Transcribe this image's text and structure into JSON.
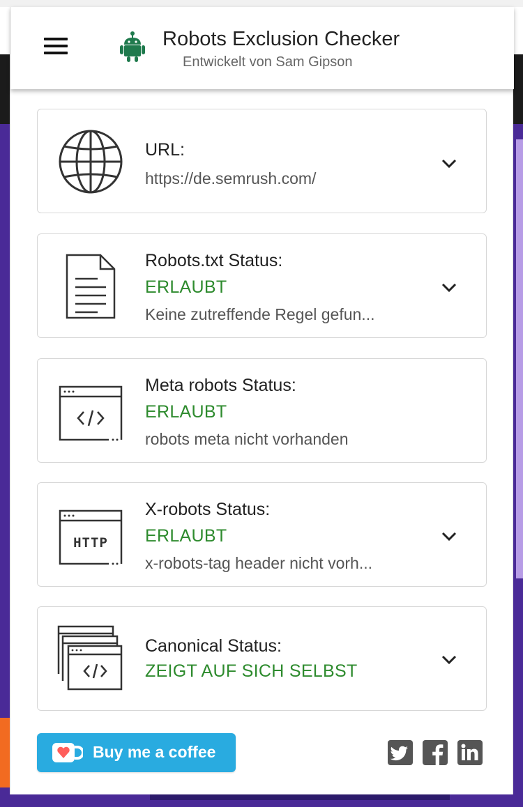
{
  "header": {
    "title": "Robots Exclusion Checker",
    "subtitle": "Entwickelt von Sam Gipson"
  },
  "cards": [
    {
      "label": "URL:",
      "status": "",
      "detail": "https://de.semrush.com/",
      "icon": "globe-icon"
    },
    {
      "label": "Robots.txt Status:",
      "status": "ERLAUBT",
      "detail": "Keine zutreffende Regel gefun...",
      "icon": "document-icon"
    },
    {
      "label": "Meta robots Status:",
      "status": "ERLAUBT",
      "detail": "robots meta nicht vorhanden",
      "icon": "code-window-icon"
    },
    {
      "label": "X-robots Status:",
      "status": "ERLAUBT",
      "detail": "x-robots-tag header nicht vorh...",
      "icon": "http-window-icon"
    },
    {
      "label": "Canonical Status:",
      "status": "ZEIGT AUF SICH SELBST",
      "detail": "",
      "icon": "stacked-windows-icon"
    }
  ],
  "footer": {
    "coffee_label": "Buy me a coffee",
    "icons": [
      "twitter-icon",
      "facebook-icon",
      "linkedin-icon"
    ]
  },
  "colors": {
    "status_green": "#2e8b2e",
    "coffee_blue": "#29abe0",
    "logo_green": "#1f7a4d",
    "background_purple": "#4a2a97"
  }
}
